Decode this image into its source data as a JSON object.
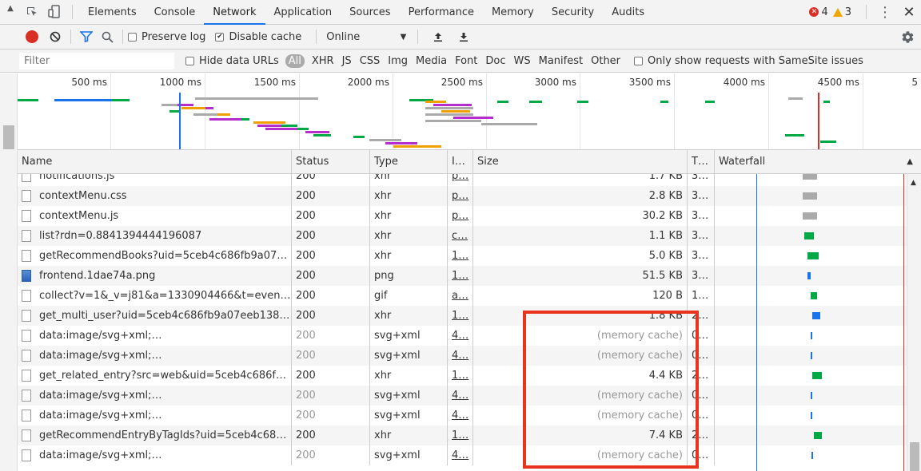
{
  "tabs": [
    "Elements",
    "Console",
    "Network",
    "Application",
    "Sources",
    "Performance",
    "Memory",
    "Security",
    "Audits"
  ],
  "active_tab": "Network",
  "errors_count": "4",
  "warnings_count": "3",
  "toolbar": {
    "preserve_log": "Preserve log",
    "disable_cache": "Disable cache",
    "throttle": "Online"
  },
  "filter": {
    "placeholder": "Filter",
    "hide_data_urls": "Hide data URLs",
    "types": [
      "All",
      "XHR",
      "JS",
      "CSS",
      "Img",
      "Media",
      "Font",
      "Doc",
      "WS",
      "Manifest",
      "Other"
    ],
    "samesite": "Only show requests with SameSite issues"
  },
  "overview_ticks": [
    "500 ms",
    "1000 ms",
    "1500 ms",
    "2000 ms",
    "2500 ms",
    "3000 ms",
    "3500 ms",
    "4000 ms",
    "4500 ms",
    "5"
  ],
  "columns": {
    "name": "Name",
    "status": "Status",
    "type": "Type",
    "initiator": "I…",
    "size": "Size",
    "time": "T…",
    "waterfall": "Waterfall"
  },
  "rows": [
    {
      "name": "notifications.js",
      "status": "200",
      "type": "xhr",
      "initiator": "p…",
      "size": "1.7 KB",
      "time": "3…",
      "icon": "file",
      "muted": false
    },
    {
      "name": "contextMenu.css",
      "status": "200",
      "type": "xhr",
      "initiator": "p…",
      "size": "2.8 KB",
      "time": "3…",
      "icon": "file",
      "muted": false
    },
    {
      "name": "contextMenu.js",
      "status": "200",
      "type": "xhr",
      "initiator": "p…",
      "size": "30.2 KB",
      "time": "3…",
      "icon": "file",
      "muted": false
    },
    {
      "name": "list?rdn=0.8841394444196087",
      "status": "200",
      "type": "xhr",
      "initiator": "c…",
      "size": "1.1 KB",
      "time": "3…",
      "icon": "file",
      "muted": false
    },
    {
      "name": "getRecommendBooks?uid=5ceb4c686fb9a07e…",
      "status": "200",
      "type": "xhr",
      "initiator": "1…",
      "size": "5.0 KB",
      "time": "3…",
      "icon": "file",
      "muted": false
    },
    {
      "name": "frontend.1dae74a.png",
      "status": "200",
      "type": "png",
      "initiator": "1…",
      "size": "51.5 KB",
      "time": "3…",
      "icon": "image",
      "muted": false
    },
    {
      "name": "collect?v=1&_v=j81&a=1330904466&t=event&…",
      "status": "200",
      "type": "gif",
      "initiator": "a…",
      "size": "120 B",
      "time": "1…",
      "icon": "file",
      "muted": false
    },
    {
      "name": "get_multi_user?uid=5ceb4c686fb9a07eeb1385f…",
      "status": "200",
      "type": "xhr",
      "initiator": "1…",
      "size": "1.8 KB",
      "time": "2…",
      "icon": "file",
      "muted": false
    },
    {
      "name": "data:image/svg+xml;…",
      "status": "200",
      "type": "svg+xml",
      "initiator": "4…",
      "size": "(memory cache)",
      "time": "0…",
      "icon": "file",
      "muted": true
    },
    {
      "name": "data:image/svg+xml;…",
      "status": "200",
      "type": "svg+xml",
      "initiator": "4…",
      "size": "(memory cache)",
      "time": "0…",
      "icon": "file",
      "muted": true
    },
    {
      "name": "get_related_entry?src=web&uid=5ceb4c686fb9…",
      "status": "200",
      "type": "xhr",
      "initiator": "1…",
      "size": "4.4 KB",
      "time": "2…",
      "icon": "file",
      "muted": false
    },
    {
      "name": "data:image/svg+xml;…",
      "status": "200",
      "type": "svg+xml",
      "initiator": "4…",
      "size": "(memory cache)",
      "time": "0…",
      "icon": "file",
      "muted": true
    },
    {
      "name": "data:image/svg+xml;…",
      "status": "200",
      "type": "svg+xml",
      "initiator": "4…",
      "size": "(memory cache)",
      "time": "0…",
      "icon": "file",
      "muted": true
    },
    {
      "name": "getRecommendEntryByTagIds?uid=5ceb4c686f…",
      "status": "200",
      "type": "xhr",
      "initiator": "1…",
      "size": "7.4 KB",
      "time": "2…",
      "icon": "file",
      "muted": false
    },
    {
      "name": "data:image/svg+xml;…",
      "status": "200",
      "type": "svg+xml",
      "initiator": "4…",
      "size": "(memory cache)",
      "time": "0…",
      "icon": "file",
      "muted": true
    }
  ],
  "colors": {
    "accent": "#1a73e8",
    "record": "#d93025",
    "highlight": "#e8341c",
    "wf_waiting": "#00a846",
    "wf_receive": "#1a73e8",
    "wf_queue": "#aaaaaa",
    "wf_ssl": "#b52dcd",
    "wf_dns": "#f0a000"
  }
}
